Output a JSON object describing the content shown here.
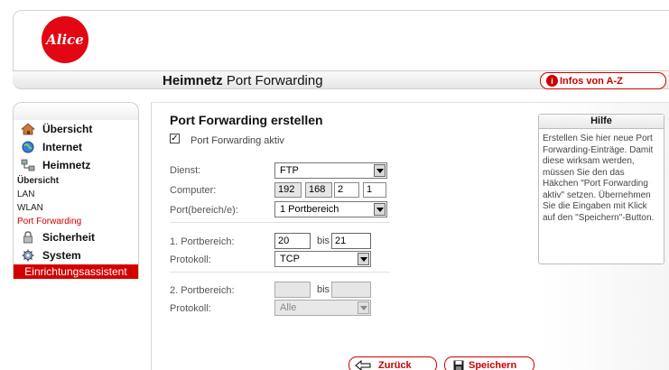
{
  "brand": {
    "logo_text": "Alice",
    "accent": "#d40000"
  },
  "header": {
    "title_bold": "Heimnetz",
    "title_rest": "Port Forwarding",
    "info_button": "Infos von A-Z"
  },
  "sidebar": {
    "items": [
      {
        "label": "Übersicht",
        "icon": "home-icon"
      },
      {
        "label": "Internet",
        "icon": "globe-icon"
      },
      {
        "label": "Heimnetz",
        "icon": "network-icon"
      }
    ],
    "sub_items": [
      {
        "label": "Übersicht"
      },
      {
        "label": "LAN"
      },
      {
        "label": "WLAN"
      },
      {
        "label": "Port Forwarding",
        "active": true
      }
    ],
    "items2": [
      {
        "label": "Sicherheit",
        "icon": "lock-icon"
      },
      {
        "label": "System",
        "icon": "gear-icon"
      }
    ],
    "wizard": "Einrichtungsassistent"
  },
  "form": {
    "title": "Port Forwarding erstellen",
    "active_checkbox": {
      "label": "Port Forwarding aktiv",
      "checked": true
    },
    "dienst": {
      "label": "Dienst:",
      "value": "FTP"
    },
    "computer": {
      "label": "Computer:",
      "octets": [
        "192",
        "168",
        "2",
        "1"
      ]
    },
    "port_range": {
      "label": "Port(bereich/e):",
      "value": "1 Portbereich"
    },
    "range1": {
      "label": "1. Portbereich:",
      "from": "20",
      "bis": "bis",
      "to": "21"
    },
    "protokoll1": {
      "label": "Protokoll:",
      "value": "TCP"
    },
    "range2": {
      "label": "2. Portbereich:",
      "from": "",
      "bis": "bis",
      "to": ""
    },
    "protokoll2": {
      "label": "Protokoll:",
      "value": "Alle"
    }
  },
  "help": {
    "title": "Hilfe",
    "text": "Erstellen Sie hier neue Port Forwarding-Einträge. Damit diese wirksam werden, müssen Sie den das Häkchen \"Port Forwarding aktiv\" setzen. Übernehmen Sie die Eingaben mit Klick auf den \"Speichern\"-Button."
  },
  "buttons": {
    "back": "Zurück",
    "save": "Speichern"
  }
}
